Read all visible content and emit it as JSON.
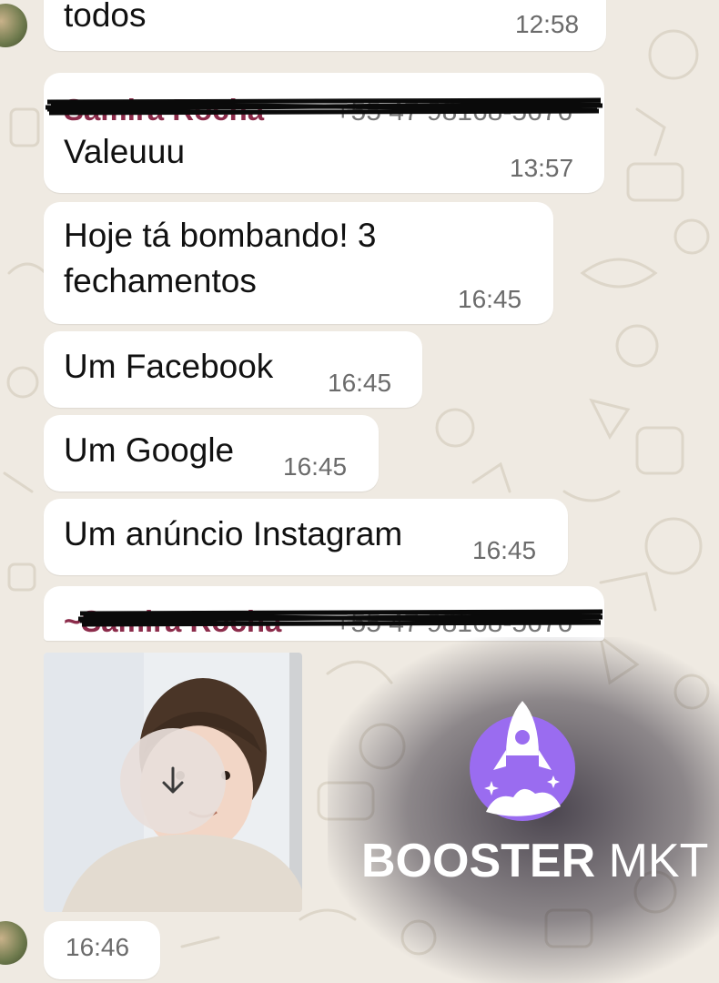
{
  "messages": [
    {
      "text": "todos",
      "time": "12:58"
    },
    {
      "sender": "Samira Rocha",
      "sender_phone": "+55 47 98168-5676",
      "text": "Valeuuu",
      "time": "13:57"
    },
    {
      "text": "Hoje tá bombando! 3\nfechamentos",
      "time": "16:45"
    },
    {
      "text": "Um Facebook",
      "time": "16:45"
    },
    {
      "text": "Um Google",
      "time": "16:45"
    },
    {
      "text": "Um anúncio Instagram",
      "time": "16:45"
    },
    {
      "sender": "~Samira Rocha",
      "sender_phone": "+55 47 98168-5676",
      "time": "16:46"
    }
  ],
  "image_message": {
    "download_icon": "arrow-down-icon"
  },
  "brand": {
    "bold": "BOOSTER",
    "light": " MKT",
    "logo_icon": "rocket-icon",
    "accent": "#9a6cf0"
  },
  "colors": {
    "background": "#efeae2",
    "bubble": "#ffffff",
    "sender": "#8b2b4a",
    "time": "#6b6b6b"
  }
}
